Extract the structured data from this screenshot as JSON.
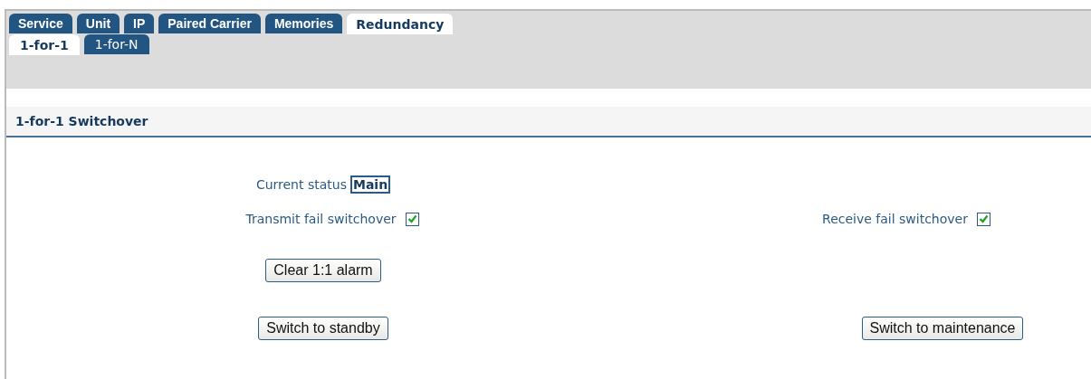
{
  "tabs": [
    {
      "label": "Service",
      "selected": false
    },
    {
      "label": "Unit",
      "selected": false
    },
    {
      "label": "IP",
      "selected": false
    },
    {
      "label": "Paired Carrier",
      "selected": false
    },
    {
      "label": "Memories",
      "selected": false
    },
    {
      "label": "Redundancy",
      "selected": true
    }
  ],
  "subtabs": [
    {
      "label": "1-for-1",
      "selected": true
    },
    {
      "label": "1-for-N",
      "selected": false
    }
  ],
  "section": {
    "title": "1-for-1 Switchover"
  },
  "current_status": {
    "label": "Current status",
    "value": "Main"
  },
  "transmit_fail": {
    "label": "Transmit fail switchover",
    "checked": true
  },
  "receive_fail": {
    "label": "Receive fail switchover",
    "checked": true
  },
  "buttons": {
    "clear_alarm": "Clear 1:1 alarm",
    "standby": "Switch to standby",
    "maintenance": "Switch to maintenance"
  }
}
